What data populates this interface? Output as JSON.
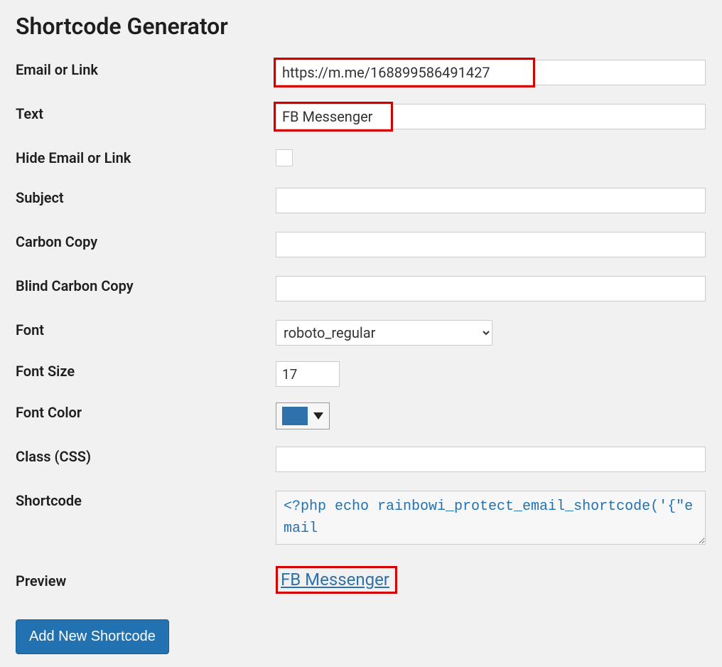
{
  "title": "Shortcode Generator",
  "labels": {
    "email": "Email or Link",
    "text": "Text",
    "hide": "Hide Email or Link",
    "subject": "Subject",
    "cc": "Carbon Copy",
    "bcc": "Blind Carbon Copy",
    "font": "Font",
    "fontsize": "Font Size",
    "fontcolor": "Font Color",
    "cssclass": "Class (CSS)",
    "shortcode": "Shortcode",
    "preview": "Preview"
  },
  "values": {
    "email": "https://m.me/168899586491427",
    "text": "FB Messenger",
    "subject": "",
    "cc": "",
    "bcc": "",
    "font": "roboto_regular",
    "fontsize": "17",
    "font_color": "#2f71aa",
    "cssclass": "",
    "shortcode": "<?php echo rainbowi_protect_email_shortcode('{\"email"
  },
  "preview": {
    "link_text": "FB Messenger"
  },
  "buttons": {
    "add_new": "Add New Shortcode"
  }
}
